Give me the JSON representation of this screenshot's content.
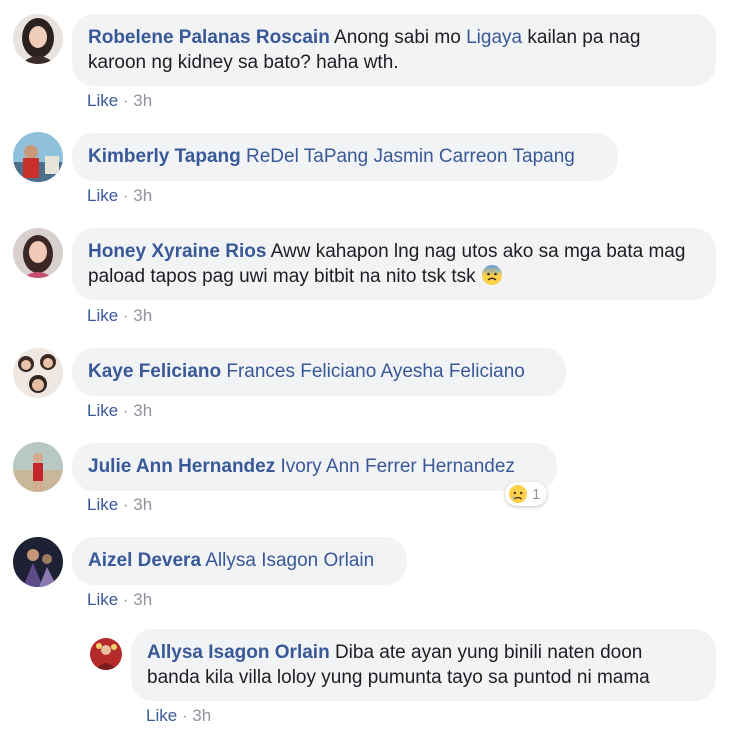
{
  "comments": [
    {
      "author": "Robelene Palanas Roscain",
      "text_pre": " Anong sabi mo ",
      "tag": "Ligaya",
      "text_post": " kailan pa nag karoon ng kidney sa bato? haha wth.",
      "like": "Like",
      "sep": " · ",
      "time": "3h",
      "avatar_icon": "profile-photo"
    },
    {
      "author": "Kimberly Tapang",
      "tags": " ReDel TaPang Jasmin Carreon Tapang",
      "like": "Like",
      "sep": " · ",
      "time": "3h",
      "avatar_icon": "profile-photo"
    },
    {
      "author": "Honey Xyraine Rios",
      "text": " Aww kahapon lng nag utos ako sa mga bata mag paload tapos pag uwi may bitbit na nito tsk tsk ",
      "emoji_icon": "anxious-face-with-sweat-emoji",
      "like": "Like",
      "sep": " · ",
      "time": "3h",
      "avatar_icon": "profile-photo"
    },
    {
      "author": "Kaye Feliciano",
      "tags": " Frances Feliciano Ayesha Feliciano",
      "like": "Like",
      "sep": " · ",
      "time": "3h",
      "avatar_icon": "profile-photo"
    },
    {
      "author": "Julie Ann Hernandez",
      "tags": " Ivory Ann Ferrer Hernandez",
      "like": "Like",
      "sep": " · ",
      "time": "3h",
      "reaction_icon": "sad-face-emoji",
      "reaction_count": "1",
      "avatar_icon": "profile-photo"
    },
    {
      "author": "Aizel Devera",
      "tags": " Allysa Isagon Orlain",
      "like": "Like",
      "sep": " · ",
      "time": "3h",
      "avatar_icon": "profile-photo"
    },
    {
      "author": "Allysa Isagon Orlain",
      "text": " Diba ate ayan yung binili naten doon banda kila villa loloy yung pumunta tayo sa puntod ni mama",
      "like": "Like",
      "sep": " · ",
      "time": "3h",
      "avatar_icon": "profile-photo",
      "is_reply": true
    }
  ],
  "colors": {
    "link": "#385898",
    "bubble": "#f2f3f5",
    "meta": "#90949c",
    "text": "#1c1e21"
  }
}
